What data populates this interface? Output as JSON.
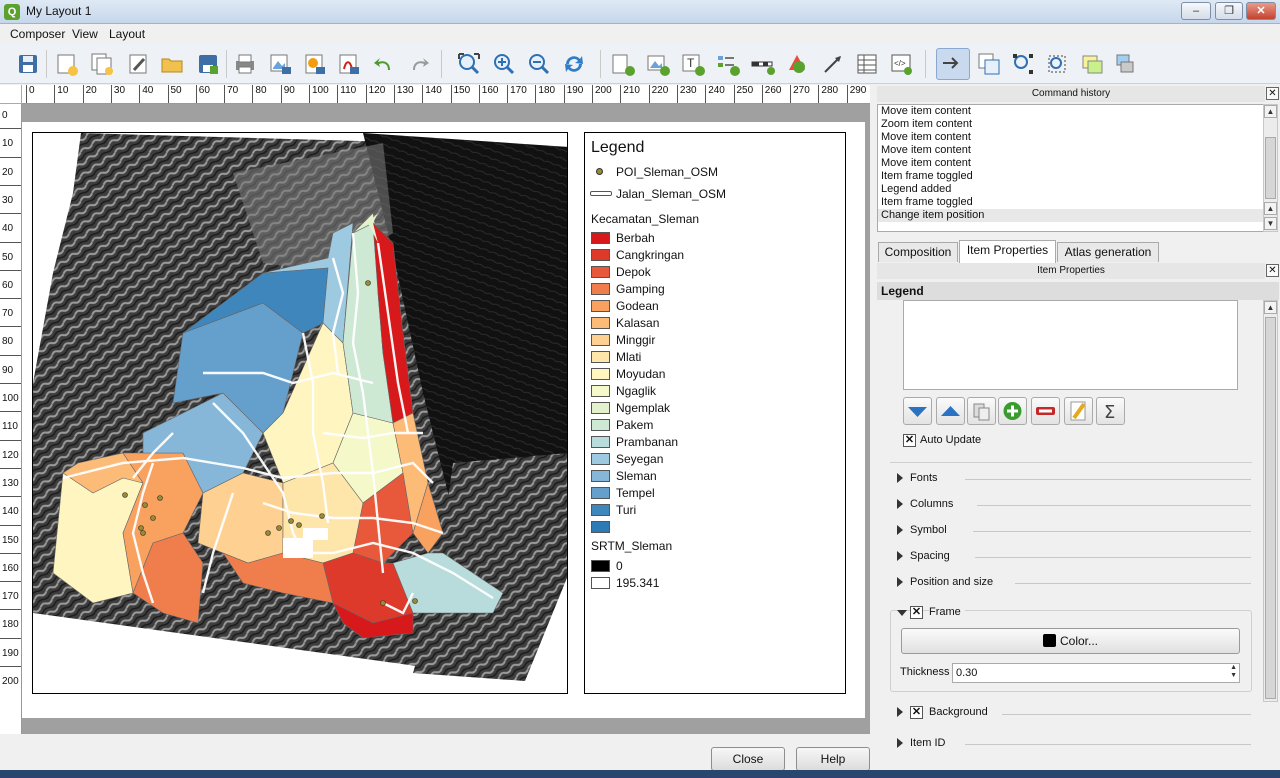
{
  "window": {
    "title": "My Layout 1"
  },
  "menu": [
    "Composer",
    "View",
    "Layout"
  ],
  "toolbar": {
    "icons": [
      "save-icon",
      "new-composer-icon",
      "duplicate-composer-icon",
      "composer-manager-icon",
      "open-template-icon",
      "save-template-icon",
      "print-icon",
      "export-image-icon",
      "export-svg-icon",
      "export-pdf-icon",
      "undo-icon",
      "redo-icon",
      "zoom-full-icon",
      "zoom-in-icon",
      "zoom-out-icon",
      "refresh-icon",
      "add-map-icon",
      "add-image-icon",
      "add-label-icon",
      "add-legend-icon",
      "add-scalebar-icon",
      "add-shape-icon",
      "add-arrow-icon",
      "add-table-icon",
      "add-html-icon",
      "select-move-icon",
      "move-content-icon",
      "edit-nodes-icon",
      "zoom-select-icon",
      "group-icon",
      "raise-icon"
    ]
  },
  "ruler": {
    "h": [
      "0",
      "10",
      "20",
      "30",
      "40",
      "50",
      "60",
      "70",
      "80",
      "90",
      "100",
      "110",
      "120",
      "130",
      "140",
      "150",
      "160",
      "170",
      "180",
      "190",
      "200",
      "210",
      "220",
      "230",
      "240",
      "250",
      "260",
      "270",
      "280",
      "290"
    ],
    "v": [
      "0",
      "10",
      "20",
      "30",
      "40",
      "50",
      "60",
      "70",
      "80",
      "90",
      "100",
      "110",
      "120",
      "130",
      "140",
      "150",
      "160",
      "170",
      "180",
      "190",
      "200"
    ]
  },
  "legend": {
    "title": "Legend",
    "poi": "POI_Sleman_OSM",
    "road": "Jalan_Sleman_OSM",
    "group": "Kecamatan_Sleman",
    "classes": [
      {
        "name": "Berbah",
        "color": "#d7191c"
      },
      {
        "name": "Cangkringan",
        "color": "#de3a2c"
      },
      {
        "name": "Depok",
        "color": "#e8593b"
      },
      {
        "name": "Gamping",
        "color": "#f07d4c"
      },
      {
        "name": "Godean",
        "color": "#f9a15f"
      },
      {
        "name": "Kalasan",
        "color": "#fdbb78"
      },
      {
        "name": "Minggir",
        "color": "#fed192"
      },
      {
        "name": "Mlati",
        "color": "#fee6ab"
      },
      {
        "name": "Moyudan",
        "color": "#fff5c0"
      },
      {
        "name": "Ngaglik",
        "color": "#f5f8c8"
      },
      {
        "name": "Ngemplak",
        "color": "#e3f1cc"
      },
      {
        "name": "Pakem",
        "color": "#cde8d3"
      },
      {
        "name": "Prambanan",
        "color": "#b7dcdb"
      },
      {
        "name": "Seyegan",
        "color": "#9ecae1"
      },
      {
        "name": "Sleman",
        "color": "#86b7d8"
      },
      {
        "name": "Tempel",
        "color": "#65a0cc"
      },
      {
        "name": "Turi",
        "color": "#3f86bd"
      },
      {
        "name": "",
        "color": "#2c7bb6"
      }
    ],
    "raster": "SRTM_Sleman",
    "raster_min": "0",
    "raster_max": "195.341"
  },
  "buttons": {
    "close": "Close",
    "help": "Help"
  },
  "history": {
    "title": "Command history",
    "items": [
      "Move item content",
      "Zoom item content",
      "Move item content",
      "Move item content",
      "Move item content",
      "Item frame toggled",
      "Legend added",
      "Item frame toggled",
      "Change item position"
    ]
  },
  "tabs": [
    "Composition",
    "Item Properties",
    "Atlas generation"
  ],
  "props": {
    "title": "Item Properties",
    "section": "Legend",
    "auto_update": "Auto Update",
    "sections": [
      "Fonts",
      "Columns",
      "Symbol",
      "Spacing",
      "Position and size"
    ],
    "frame": "Frame",
    "color_btn": "Color...",
    "thickness_label": "Thickness",
    "thickness": "0.30",
    "background": "Background",
    "item_id": "Item ID"
  }
}
